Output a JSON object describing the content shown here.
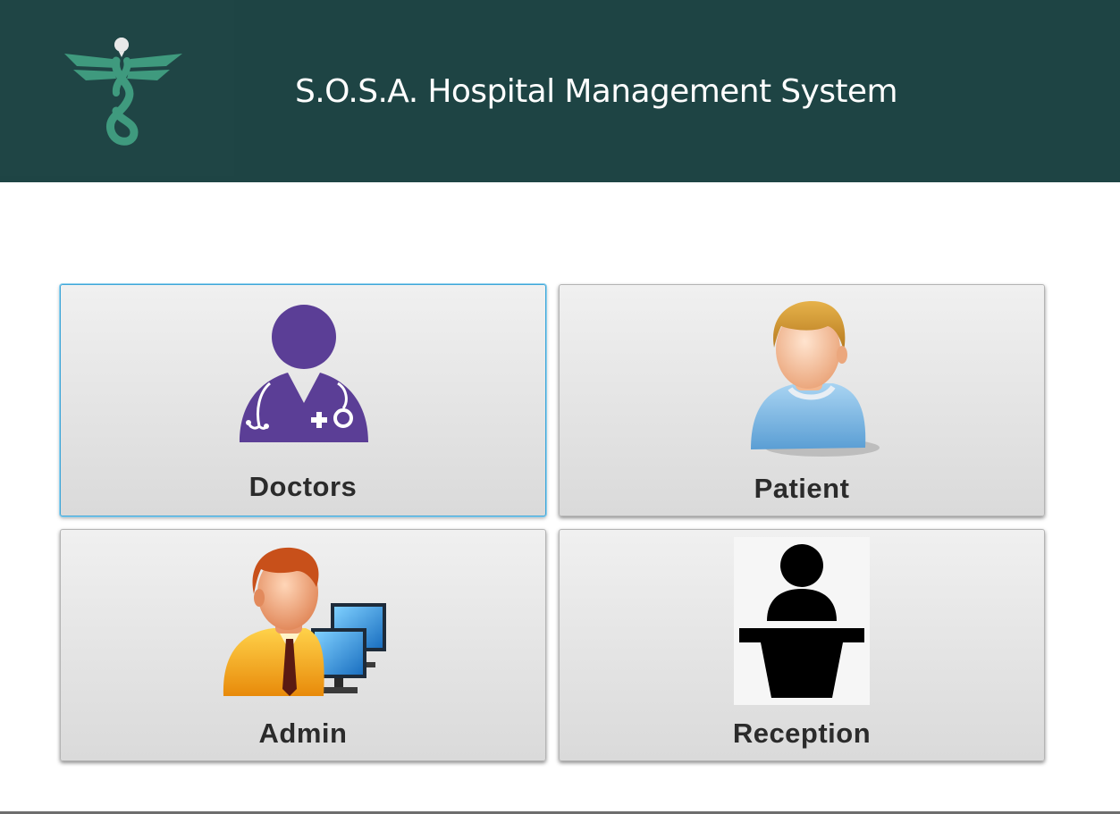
{
  "header": {
    "title": "S.O.S.A. Hospital Management System",
    "background": "#1e4444",
    "logo_icon": "caduceus-logo-icon"
  },
  "tiles": [
    {
      "label": "Doctors",
      "icon": "doctor-icon",
      "focused": true
    },
    {
      "label": "Patient",
      "icon": "patient-icon",
      "focused": false
    },
    {
      "label": "Admin",
      "icon": "admin-computer-icon",
      "focused": false
    },
    {
      "label": "Reception",
      "icon": "reception-desk-icon",
      "focused": false
    }
  ],
  "colors": {
    "doctor_icon": "#5b3e96",
    "logo_green": "#3f9a7e",
    "focus_border": "#3fa6d8"
  }
}
